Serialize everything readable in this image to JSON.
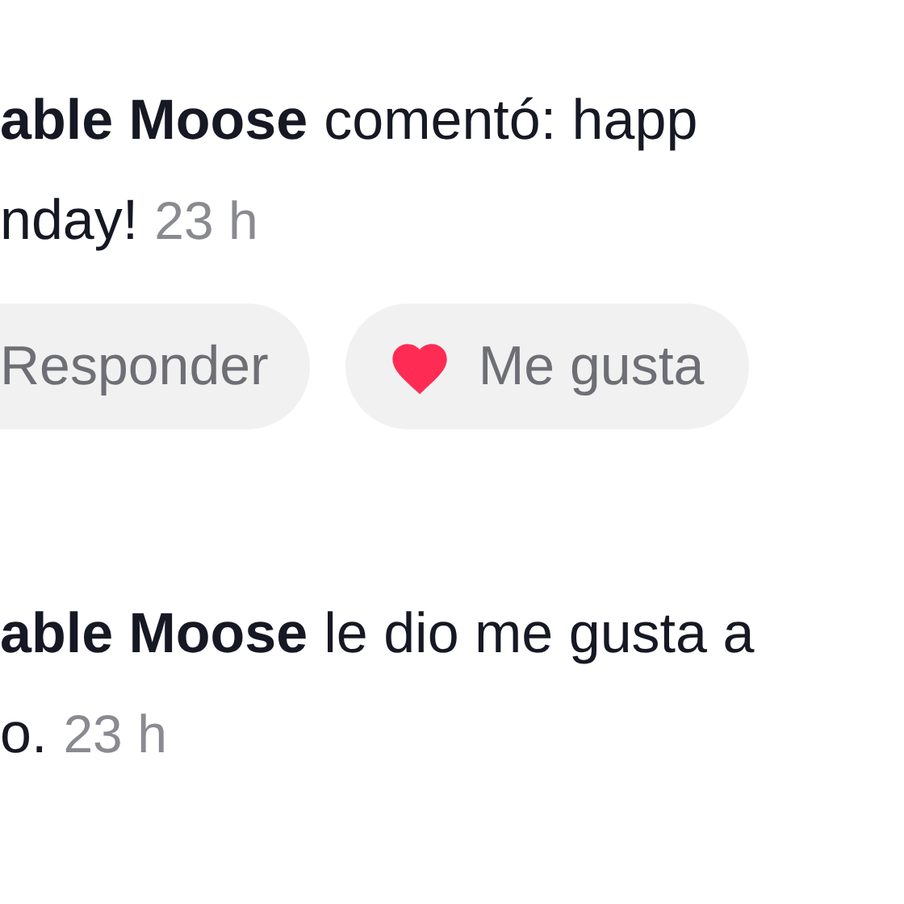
{
  "notifications": [
    {
      "user": "able Moose",
      "action": "comentó: happ",
      "continuation": "nday!",
      "time": "23 h",
      "buttons": [
        {
          "kind": "reply",
          "label": "Responder"
        },
        {
          "kind": "like",
          "label": "Me gusta"
        }
      ]
    },
    {
      "user": "able Moose",
      "action": "le dio me gusta a",
      "continuation": "o.",
      "time": "23 h"
    }
  ]
}
